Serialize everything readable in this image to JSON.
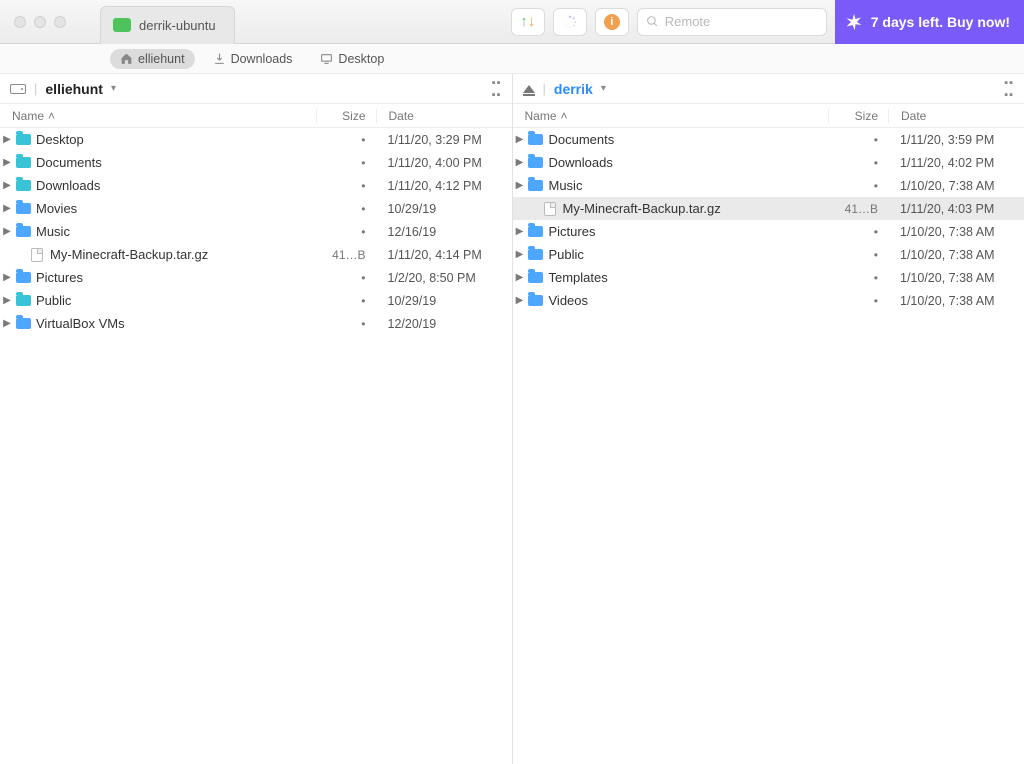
{
  "window": {
    "tab_label": "derrik-ubuntu",
    "search_placeholder": "Remote",
    "banner_text": "7 days left. Buy now!"
  },
  "breadcrumbs": [
    {
      "label": "elliehunt",
      "pill": true,
      "icon": "home"
    },
    {
      "label": "Downloads",
      "pill": false,
      "icon": "download"
    },
    {
      "label": "Desktop",
      "pill": false,
      "icon": "desktop"
    }
  ],
  "columns": {
    "name": "Name",
    "size": "Size",
    "date": "Date"
  },
  "panes": {
    "left": {
      "location": "elliehunt",
      "files": [
        {
          "kind": "folder",
          "color": "teal",
          "name": "Desktop",
          "size": "•",
          "date": "1/11/20, 3:29 PM"
        },
        {
          "kind": "folder",
          "color": "teal",
          "name": "Documents",
          "size": "•",
          "date": "1/11/20, 4:00 PM"
        },
        {
          "kind": "folder",
          "color": "teal",
          "name": "Downloads",
          "size": "•",
          "date": "1/11/20, 4:12 PM"
        },
        {
          "kind": "folder",
          "color": "blue",
          "name": "Movies",
          "size": "•",
          "date": "10/29/19"
        },
        {
          "kind": "folder",
          "color": "blue",
          "name": "Music",
          "size": "•",
          "date": "12/16/19"
        },
        {
          "kind": "file",
          "indent": true,
          "name": "My-Minecraft-Backup.tar.gz",
          "size": "41…B",
          "date": "1/11/20, 4:14 PM"
        },
        {
          "kind": "folder",
          "color": "blue",
          "name": "Pictures",
          "size": "•",
          "date": "1/2/20, 8:50 PM"
        },
        {
          "kind": "folder",
          "color": "teal",
          "name": "Public",
          "size": "•",
          "date": "10/29/19"
        },
        {
          "kind": "folder",
          "color": "blue",
          "name": "VirtualBox VMs",
          "size": "•",
          "date": "12/20/19"
        }
      ]
    },
    "right": {
      "location": "derrik",
      "files": [
        {
          "kind": "folder",
          "color": "blue",
          "name": "Documents",
          "size": "•",
          "date": "1/11/20, 3:59 PM"
        },
        {
          "kind": "folder",
          "color": "blue",
          "name": "Downloads",
          "size": "•",
          "date": "1/11/20, 4:02 PM"
        },
        {
          "kind": "folder",
          "color": "blue",
          "name": "Music",
          "size": "•",
          "date": "1/10/20, 7:38 AM"
        },
        {
          "kind": "file",
          "indent": true,
          "selected": true,
          "name": "My-Minecraft-Backup.tar.gz",
          "size": "41…B",
          "date": "1/11/20, 4:03 PM"
        },
        {
          "kind": "folder",
          "color": "blue",
          "name": "Pictures",
          "size": "•",
          "date": "1/10/20, 7:38 AM"
        },
        {
          "kind": "folder",
          "color": "blue",
          "name": "Public",
          "size": "•",
          "date": "1/10/20, 7:38 AM"
        },
        {
          "kind": "folder",
          "color": "blue",
          "name": "Templates",
          "size": "•",
          "date": "1/10/20, 7:38 AM"
        },
        {
          "kind": "folder",
          "color": "blue",
          "name": "Videos",
          "size": "•",
          "date": "1/10/20, 7:38 AM"
        }
      ]
    }
  }
}
